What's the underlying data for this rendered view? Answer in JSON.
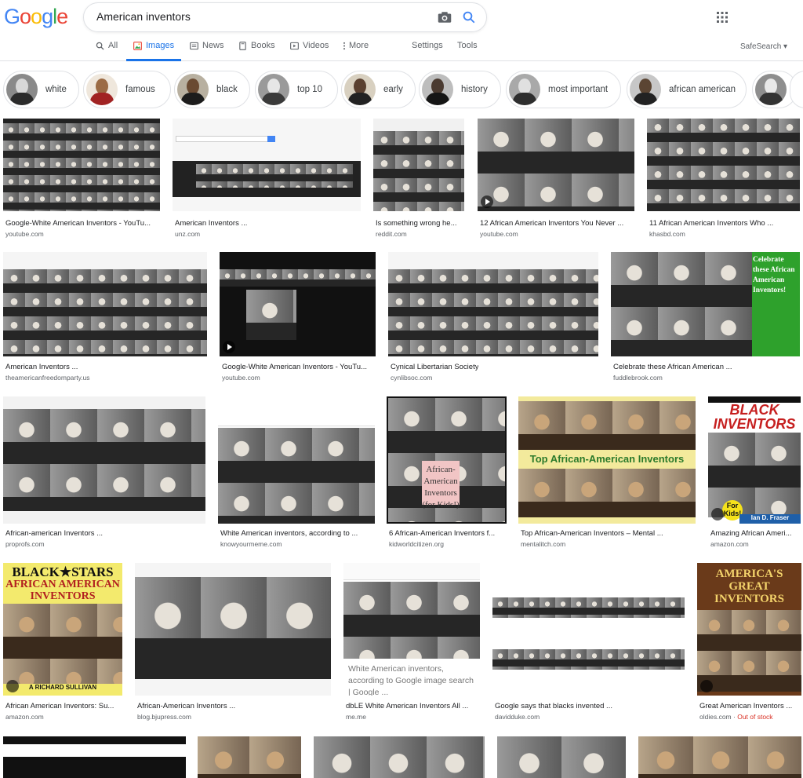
{
  "logo": "Google",
  "search": {
    "value": "American inventors"
  },
  "tabs": [
    {
      "label": "All"
    },
    {
      "label": "Images"
    },
    {
      "label": "News"
    },
    {
      "label": "Books"
    },
    {
      "label": "Videos"
    },
    {
      "label": "More"
    }
  ],
  "tools": {
    "settings": "Settings",
    "tools": "Tools",
    "safesearch": "SafeSearch ▾"
  },
  "chips": [
    "white",
    "famous",
    "black",
    "top 10",
    "early",
    "history",
    "most important",
    "african american"
  ],
  "results": [
    {
      "title": "Google-White American Inventors - YouTu...",
      "domain": "youtube.com"
    },
    {
      "title": "American Inventors ...",
      "domain": "unz.com"
    },
    {
      "title": "Is something wrong he...",
      "domain": "reddit.com"
    },
    {
      "title": "12 African American Inventors You Never ...",
      "domain": "youtube.com"
    },
    {
      "title": "11 African American Inventors Who ...",
      "domain": "khasbd.com"
    },
    {
      "title": "American Inventors ...",
      "domain": "theamericanfreedomparty.us"
    },
    {
      "title": "Google-White American Inventors - YouTu...",
      "domain": "youtube.com"
    },
    {
      "title": "Cynical Libertarian Society",
      "domain": "cynlibsoc.com"
    },
    {
      "title": "Celebrate these African American ...",
      "domain": "fuddlebrook.com"
    },
    {
      "title": "African-american Inventors ...",
      "domain": "proprofs.com"
    },
    {
      "title": "White American inventors, according to ...",
      "domain": "knowyourmeme.com"
    },
    {
      "title": "6 African-American Inventors f...",
      "domain": "kidworldcitizen.org"
    },
    {
      "title": "Top African-American Inventors – Mental ...",
      "domain": "mentalitch.com"
    },
    {
      "title": "Amazing African Ameri...",
      "domain": "amazon.com"
    },
    {
      "title": "African American Inventors: Su...",
      "domain": "amazon.com"
    },
    {
      "title": "African-American Inventors ...",
      "domain": "blog.bjupress.com"
    },
    {
      "title": "dbLE White American Inventors All ...",
      "domain": "me.me"
    },
    {
      "title": "Google says that blacks invented ...",
      "domain": "davidduke.com"
    },
    {
      "title": "Great American Inventors ...",
      "domain": "oldies.com",
      "status": "Out of stock"
    }
  ],
  "overlays": {
    "celebrate": "Celebrate these African American Inventors!",
    "kids": "African-American Inventors (for Kids!)",
    "top": "Top African-American Inventors",
    "black_inventors": "BLACK INVENTORS",
    "black_stars": "BLACK★STARS",
    "book_title": "AFRICAN AMERICAN INVENTORS",
    "book_author": "A RICHARD SULLIVAN",
    "great": "AMERICA'S GREAT INVENTORS",
    "for_kids": "For Kids!",
    "author2": "Ian D. Fraser",
    "google_note": "White American inventors, according to Google image search | Google ..."
  },
  "colors": {
    "blue": "#1a73e8",
    "grey": "#5f6368",
    "red": "#d93025"
  }
}
